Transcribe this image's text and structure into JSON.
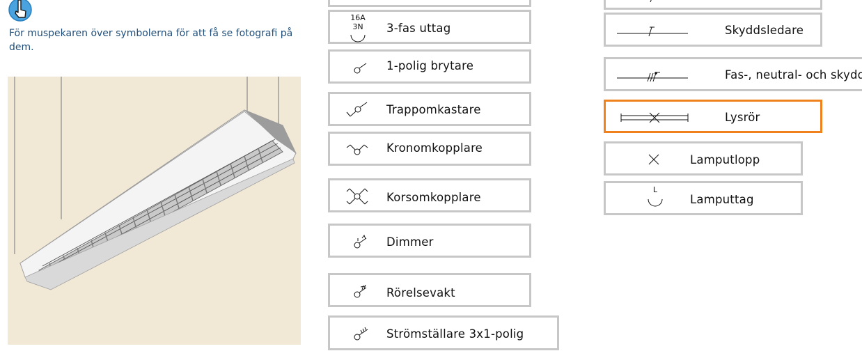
{
  "instructions": "För muspekaren över symbolerna för att få se fotografi på dem.",
  "hover_icon": "pointer-hand-icon",
  "photo": {
    "subject": "fluorescent-ceiling-light-fixture",
    "background_color": "#f1e8d6"
  },
  "symbols_left": [
    {
      "id": "top-partial",
      "label": ""
    },
    {
      "id": "3-fas-uttag",
      "label": "3-fas uttag",
      "glyph_text_top": "16A",
      "glyph_text_bottom": "3N"
    },
    {
      "id": "1-polig-brytare",
      "label": "1-polig brytare"
    },
    {
      "id": "trappomkastare",
      "label": "Trappomkastare"
    },
    {
      "id": "kronomkopplare",
      "label": "Kronomkopplare"
    },
    {
      "id": "korsomkopplare",
      "label": "Korsomkopplare"
    },
    {
      "id": "dimmer",
      "label": "Dimmer"
    },
    {
      "id": "rorelsevakt",
      "label": "Rörelsevakt"
    },
    {
      "id": "stromstallare",
      "label": "Strömställare 3x1-polig"
    }
  ],
  "symbols_right": [
    {
      "id": "top-partial",
      "label": ""
    },
    {
      "id": "skyddsledare",
      "label": "Skyddsledare"
    },
    {
      "id": "fas-neutral",
      "label": "Fas-, neutral- och skydd"
    },
    {
      "id": "lysror",
      "label": "Lysrör",
      "selected": true
    },
    {
      "id": "lamputlopp",
      "label": "Lamputlopp"
    },
    {
      "id": "lamputtag",
      "label": "Lamputtag",
      "glyph_text": "L"
    }
  ],
  "colors": {
    "box_border": "#c7c7c7",
    "selected_border": "#f0821e",
    "instruction_text": "#1f4e7a"
  }
}
